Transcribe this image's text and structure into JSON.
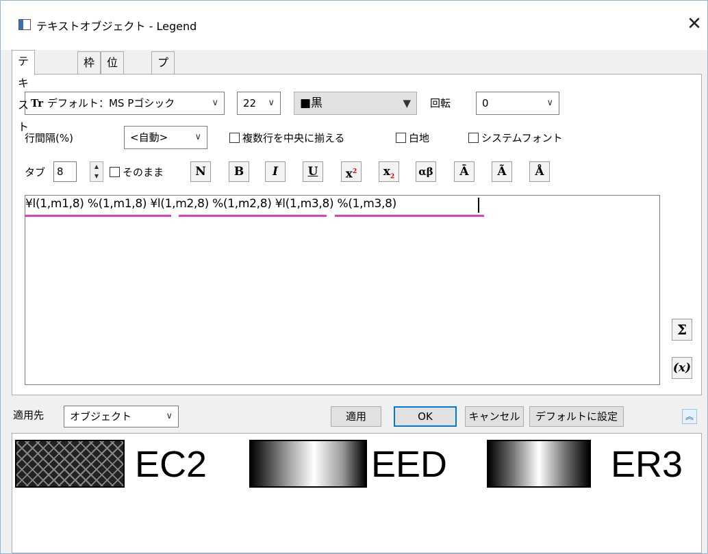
{
  "window": {
    "title": "テキストオブジェクト - Legend",
    "close": "✕"
  },
  "tabs": [
    "テキスト",
    "枠",
    "位置",
    "プログラミング"
  ],
  "toolbar": {
    "font_icon": "Tr",
    "font": "デフォルト：MS Pゴシック",
    "size": "22",
    "color": "■黒",
    "rotation_label": "回転",
    "rotation": "0",
    "line_spacing_label": "行間隔(%)",
    "line_spacing": "<自動>",
    "center_multiline": "複数行を中央に揃える",
    "white_bg": "白地",
    "system_font": "システムフォント",
    "tab_label": "タブ",
    "tab_value": "8",
    "as_is": "そのまま",
    "format_buttons": [
      "N",
      "B",
      "I",
      "U",
      "x2",
      "x2",
      "αβ",
      "Ā",
      "Ã",
      "Å"
    ]
  },
  "editor": {
    "text": "¥l(1,m1,8) %(1,m1,8) ¥l(1,m2,8) %(1,m2,8) ¥l(1,m3,8) %(1,m3,8)"
  },
  "side_buttons": {
    "sigma": "Σ",
    "var": "(x)"
  },
  "bottom": {
    "apply_to_label": "適用先",
    "apply_to": "オブジェクト",
    "apply": "適用",
    "ok": "OK",
    "cancel": "キャンセル",
    "set_default": "デフォルトに設定",
    "collapse": "︽"
  },
  "preview": {
    "items": [
      "EC2",
      "EED",
      "ER3"
    ]
  },
  "colors": {
    "accent": "#0078d7",
    "underline": "#e03cc8"
  }
}
